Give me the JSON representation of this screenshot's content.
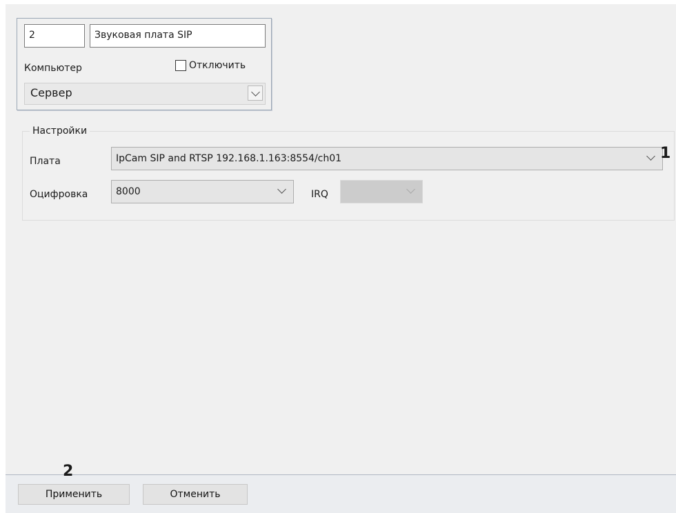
{
  "object_header": {
    "id_value": "2",
    "name_value": "Звуковая плата SIP",
    "computer_label": "Компьютер",
    "disable_label": "Отключить",
    "computer_value": "Сервер"
  },
  "settings": {
    "group_title": "Настройки",
    "board_label": "Плата",
    "board_value": "IpCam SIP and RTSP 192.168.1.163:8554/ch01",
    "digitization_label": "Оцифровка",
    "digitization_value": "8000",
    "irq_label": "IRQ",
    "irq_value": ""
  },
  "footer": {
    "apply_label": "Применить",
    "cancel_label": "Отменить"
  },
  "annotations": {
    "marker_1": "1",
    "marker_2": "2"
  },
  "icons": {
    "dropdown": "chevron-down-icon",
    "checkbox": "checkbox-icon"
  },
  "colors": {
    "panel_bg": "#f0f0f0",
    "header_box_border": "#9aa6b5",
    "button_bg": "#e3e3e3",
    "footer_bg": "#ebedf0"
  }
}
